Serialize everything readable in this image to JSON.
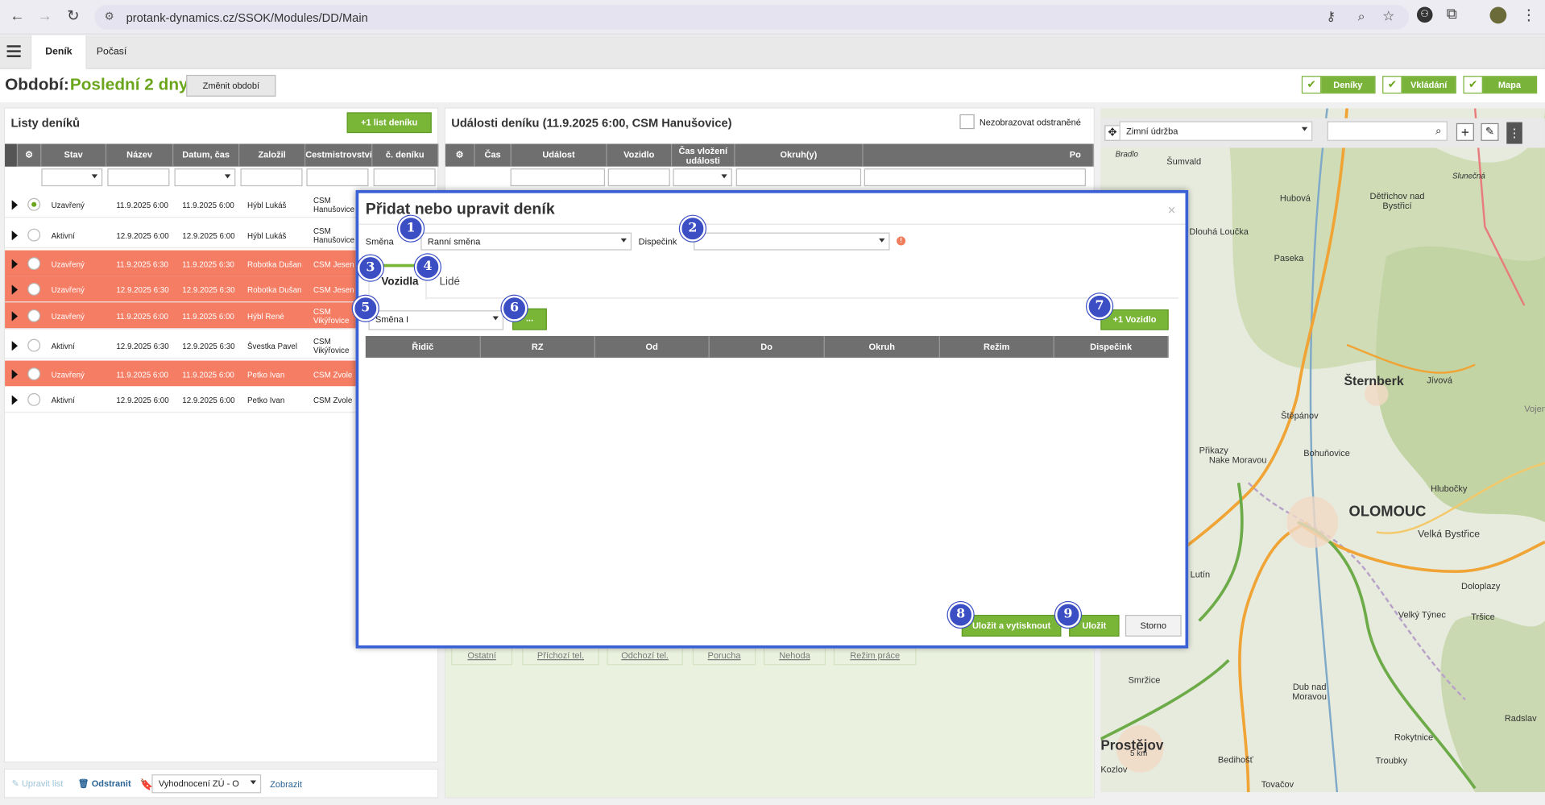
{
  "browser": {
    "url": "protank-dynamics.cz/SSOK/Modules/DD/Main"
  },
  "app_tabs": [
    {
      "label": "Deník",
      "active": true
    },
    {
      "label": "Počasí",
      "active": false
    }
  ],
  "period": {
    "label": "Období:",
    "value": "Poslední 2 dny",
    "change_button": "Změnit období"
  },
  "view_toggles": [
    {
      "label": "Deníky",
      "checked": true
    },
    {
      "label": "Vkládání",
      "checked": true
    },
    {
      "label": "Mapa",
      "checked": true
    }
  ],
  "journals": {
    "title": "Listy deníků",
    "add_button": "+1 list deníku",
    "columns": [
      "Stav",
      "Název",
      "Datum, čas",
      "Založil",
      "Cestmistrovství",
      "č. deníku"
    ],
    "rows": [
      {
        "state": "Uzavřený",
        "name": "11.9.2025 6:00",
        "datetime": "11.9.2025 6:00",
        "author": "Hýbl Lukáš",
        "office": "CSM Hanušovice",
        "highlight": false,
        "selected": true
      },
      {
        "state": "Aktivní",
        "name": "12.9.2025 6:00",
        "datetime": "12.9.2025 6:00",
        "author": "Hýbl Lukáš",
        "office": "CSM Hanušovice",
        "highlight": false,
        "selected": false
      },
      {
        "state": "Uzavřený",
        "name": "11.9.2025 6:30",
        "datetime": "11.9.2025 6:30",
        "author": "Robotka Dušan",
        "office": "CSM Jesen",
        "highlight": true,
        "selected": false
      },
      {
        "state": "Uzavřený",
        "name": "12.9.2025 6:30",
        "datetime": "12.9.2025 6:30",
        "author": "Robotka Dušan",
        "office": "CSM Jesen",
        "highlight": true,
        "selected": false
      },
      {
        "state": "Uzavřený",
        "name": "11.9.2025 6:00",
        "datetime": "11.9.2025 6:00",
        "author": "Hýbl René",
        "office": "CSM Vikýřovice",
        "highlight": true,
        "selected": false
      },
      {
        "state": "Aktivní",
        "name": "12.9.2025 6:30",
        "datetime": "12.9.2025 6:30",
        "author": "Švestka Pavel",
        "office": "CSM Vikýřovice",
        "highlight": false,
        "selected": false
      },
      {
        "state": "Uzavřený",
        "name": "11.9.2025 6:00",
        "datetime": "11.9.2025 6:00",
        "author": "Petko Ivan",
        "office": "CSM Zvole",
        "highlight": true,
        "selected": false
      },
      {
        "state": "Aktivní",
        "name": "12.9.2025 6:00",
        "datetime": "12.9.2025 6:00",
        "author": "Petko Ivan",
        "office": "CSM Zvole",
        "highlight": false,
        "selected": false
      }
    ],
    "footer": {
      "edit": "Upravit list",
      "remove": "Odstranit",
      "report_select": "Vyhodnocení ZÚ - O",
      "show": "Zobrazit"
    }
  },
  "events": {
    "title": "Události deníku (11.9.2025 6:00, CSM Hanušovice)",
    "hide_removed": "Nezobrazovat odstraněné",
    "columns": [
      "Čas",
      "Událost",
      "Vozidlo",
      "Čas vložení události",
      "Okruh(y)",
      "Po"
    ],
    "quick_buttons": [
      "Ostatní",
      "Příchozí tel.",
      "Odchozí tel.",
      "Porucha",
      "Nehoda",
      "Režim práce"
    ]
  },
  "map": {
    "layer_select": "Zimní údržba",
    "scale": "5 km",
    "places": [
      "Šumvald",
      "Hlubočky",
      "Dlouhá Loučka",
      "Paseka",
      "Šternberk",
      "Jívová",
      "Štěpánov",
      "Bohuňovice",
      "Přikazy",
      "Nake Moravou",
      "OLOMOUC",
      "Velká Bystřice",
      "Lutín",
      "Doloplazy",
      "Velký Týnec",
      "Tršice",
      "Smržice",
      "Dub nad Moravou",
      "Prostějov",
      "Bedihošť",
      "Rokytnice",
      "Troubky",
      "Tovačov",
      "Hlubočky",
      "Hubová",
      "Dětřichov nad Bystřicí",
      "Bradlo",
      "Slunečná",
      "Vojen",
      "Radslav",
      "Kozlov"
    ]
  },
  "modal": {
    "title": "Přidat nebo upravit deník",
    "shift_label": "Směna",
    "shift_value": "Ranní směna",
    "dispatcher_label": "Dispečink",
    "dispatcher_value": "",
    "tabs": [
      "Vozidla",
      "Lidé"
    ],
    "shift_group_value": "Směna I",
    "more_button": "...",
    "add_vehicle": "+1 Vozidlo",
    "columns": [
      "Řidič",
      "RZ",
      "Od",
      "Do",
      "Okruh",
      "Režim",
      "Dispečink"
    ],
    "save_print": "Uložit a vytisknout",
    "save": "Uložit",
    "cancel": "Storno",
    "badges": [
      "1",
      "2",
      "3",
      "4",
      "5",
      "6",
      "7",
      "8",
      "9"
    ]
  }
}
